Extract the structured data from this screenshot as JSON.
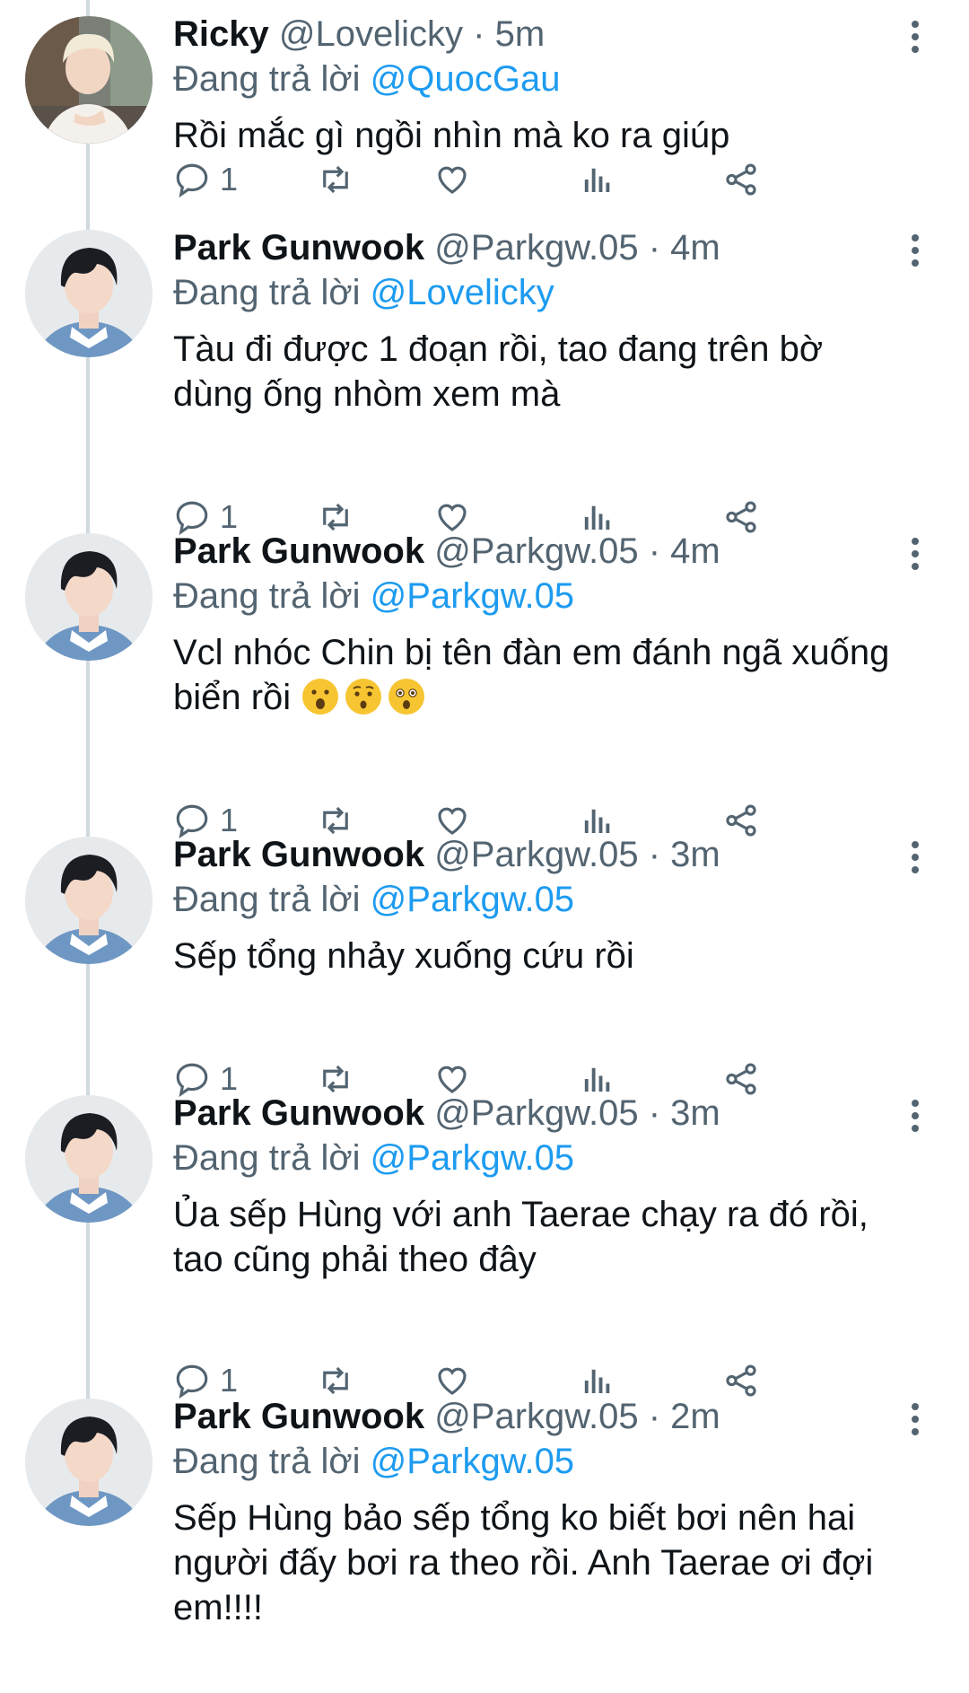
{
  "reply_prefix": "Đang trả lời",
  "tweets": [
    {
      "name": "Ricky",
      "handle": "@Lovelicky",
      "time": "5m",
      "reply_to": "@QuocGau",
      "text": "Rồi mắc gì ngồi nhìn mà ko ra giúp",
      "reply_count": "1",
      "avatar": "blonde-avatar"
    },
    {
      "name": "Park Gunwook",
      "handle": "@Parkgw.05",
      "time": "4m",
      "reply_to": "@Lovelicky",
      "text": "Tàu đi được 1 đoạn rồi, tao đang trên bờ\ndùng ống nhòm xem mà",
      "reply_count": "1",
      "avatar": "dark-hair-avatar"
    },
    {
      "name": "Park Gunwook",
      "handle": "@Parkgw.05",
      "time": "4m",
      "reply_to": "@Parkgw.05",
      "text": "Vcl nhóc Chin bị tên đàn em đánh ngã xuống\nbiển rồi",
      "emojis": [
        "face-with-open-mouth",
        "hushed-face",
        "astonished-face"
      ],
      "reply_count": "1",
      "avatar": "dark-hair-avatar"
    },
    {
      "name": "Park Gunwook",
      "handle": "@Parkgw.05",
      "time": "3m",
      "reply_to": "@Parkgw.05",
      "text": "Sếp tổng nhảy xuống cứu rồi",
      "reply_count": "1",
      "avatar": "dark-hair-avatar"
    },
    {
      "name": "Park Gunwook",
      "handle": "@Parkgw.05",
      "time": "3m",
      "reply_to": "@Parkgw.05",
      "text": "Ủa sếp Hùng với anh Taerae chạy ra đó rồi,\ntao cũng phải theo đây",
      "reply_count": "1",
      "avatar": "dark-hair-avatar"
    },
    {
      "name": "Park Gunwook",
      "handle": "@Parkgw.05",
      "time": "2m",
      "reply_to": "@Parkgw.05",
      "text": "Sếp Hùng bảo sếp tổng ko biết bơi nên hai\nngười đấy bơi ra theo rồi. Anh Taerae ơi đợi\nem!!!!",
      "avatar": "dark-hair-avatar"
    }
  ],
  "colors": {
    "mention": "#1d9bf0",
    "muted": "#536471",
    "thread_line": "#cfd9de"
  }
}
